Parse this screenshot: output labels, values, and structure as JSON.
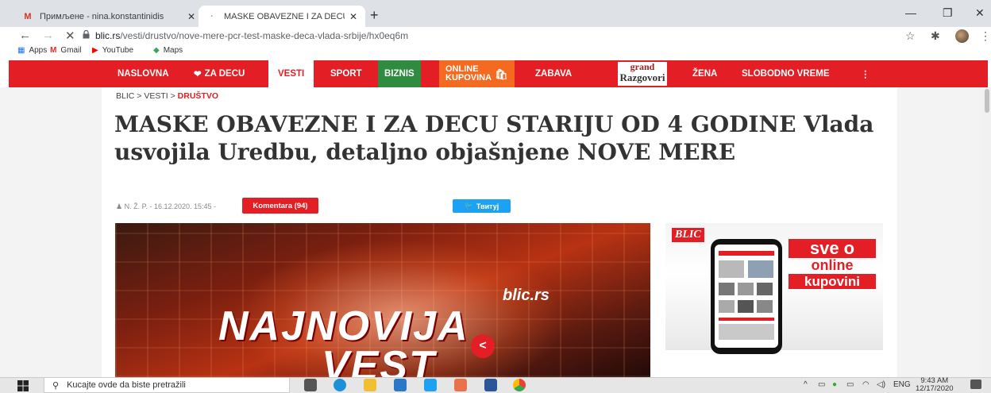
{
  "browser": {
    "tabs": [
      {
        "label": "Примљене - nina.konstantinidis",
        "icon": "gmail-icon",
        "close": "✕"
      },
      {
        "label": "MASKE OBAVEZNE I ZA DECU ST",
        "icon": "loading-icon",
        "close": "✕"
      }
    ],
    "new_tab": "+",
    "window_controls": {
      "minimize": "—",
      "restore": "❐",
      "close": "✕"
    },
    "nav": {
      "back": "←",
      "forward": "→",
      "stop": "✕"
    },
    "url_host": "blic.rs",
    "url_path": "/vesti/drustvo/nove-mere-pcr-test-maske-deca-vlada-srbije/hx0eq6m",
    "toolbar_icons": {
      "star": "☆",
      "extensions": "✱",
      "menu": "⋮"
    },
    "bookmarks": [
      {
        "label": "Apps",
        "icon": "apps-grid-icon"
      },
      {
        "label": "Gmail",
        "icon": "gmail-icon"
      },
      {
        "label": "YouTube",
        "icon": "youtube-icon"
      },
      {
        "label": "Maps",
        "icon": "maps-icon"
      }
    ]
  },
  "site_nav": {
    "items": [
      {
        "label": "NASLOVNA"
      },
      {
        "label": "ZA DECU",
        "icon": "heart-icon"
      },
      {
        "label": "VESTI",
        "active": true
      },
      {
        "label": "SPORT"
      },
      {
        "label": "BIZNIS"
      },
      {
        "label_line1": "ONLINE",
        "label_line2": "KUPOVINA",
        "icon": "shopping-bag-icon"
      },
      {
        "label": "ZABAVA"
      },
      {
        "label": "ŽENA"
      },
      {
        "label": "SLOBODNO VREME"
      },
      {
        "label": "⋮"
      }
    ],
    "grand": {
      "line1": "grand",
      "line2": "Razgovori"
    },
    "colors": {
      "primary": "#e31e24",
      "biznis": "#2e8b3f",
      "online": "#f36a20"
    }
  },
  "article": {
    "breadcrumb": {
      "root": "BLIC",
      "section": "VESTI",
      "current": "DRUŠTVO",
      "sep": ">"
    },
    "headline": "MASKE OBAVEZNE I ZA DECU STARIJU OD 4 GODINE Vlada usvojila Uredbu, detaljno objašnjene NOVE MERE",
    "author": "N. Ž. P.",
    "date": "16.12.2020. 15:45",
    "comments": "Komentara (94)",
    "tweet": "Твитуј",
    "hero": {
      "site": "blic.rs",
      "line1": "NAJNOVIJA",
      "line2": "VEST"
    }
  },
  "ad": {
    "logo": "BLIC",
    "line1": "sve o",
    "line2": "online",
    "line3": "kupovini"
  },
  "taskbar": {
    "search_placeholder": "Kucajte ovde da biste pretražili",
    "lang": "ENG",
    "time": "9:43 AM",
    "date": "12/17/2020"
  }
}
